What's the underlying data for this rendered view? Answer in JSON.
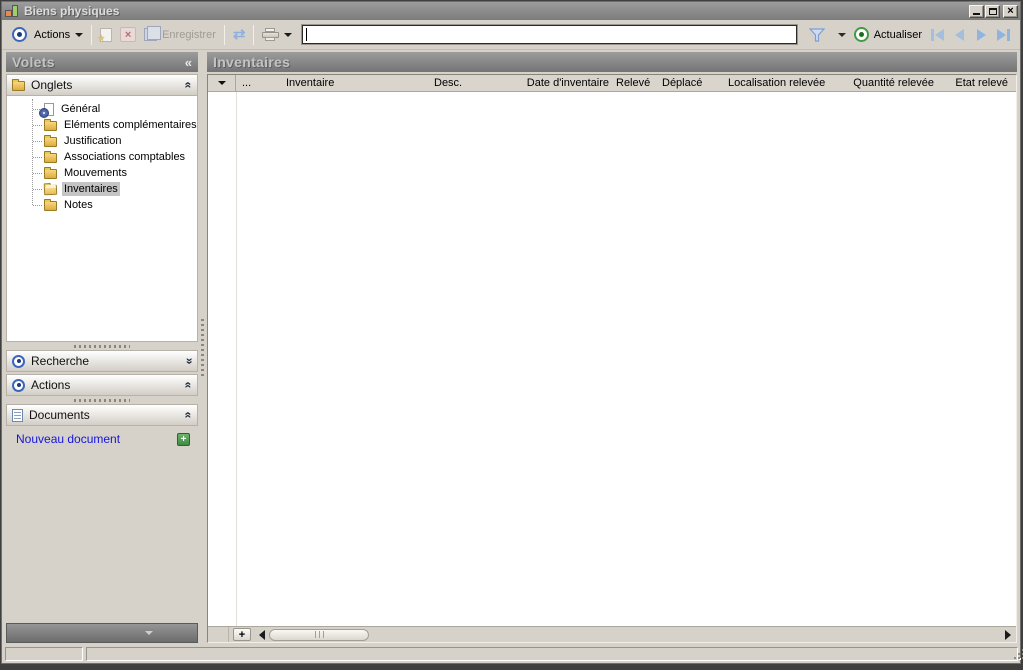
{
  "window": {
    "title": "Biens physiques"
  },
  "icons": {
    "close": "×",
    "collapse_left": "«",
    "double_chevron": "«",
    "sync_arrows": "⇄",
    "star": "★",
    "plus": "+"
  },
  "toolbar": {
    "actions_label": "Actions",
    "save_label": "Enregistrer",
    "refresh_label": "Actualiser",
    "search_value": ""
  },
  "sidebar": {
    "title": "Volets",
    "onglets": {
      "label": "Onglets",
      "items": [
        {
          "id": "general",
          "label": "Général",
          "icon": "page-gear",
          "selected": false
        },
        {
          "id": "elements-complementaires",
          "label": "Eléments complémentaires",
          "icon": "folder",
          "selected": false
        },
        {
          "id": "justification",
          "label": "Justification",
          "icon": "folder",
          "selected": false
        },
        {
          "id": "associations-comptables",
          "label": "Associations comptables",
          "icon": "folder",
          "selected": false
        },
        {
          "id": "mouvements",
          "label": "Mouvements",
          "icon": "folder",
          "selected": false
        },
        {
          "id": "inventaires",
          "label": "Inventaires",
          "icon": "folder-open",
          "selected": true
        },
        {
          "id": "notes",
          "label": "Notes",
          "icon": "folder",
          "selected": false
        }
      ]
    },
    "recherche_label": "Recherche",
    "actions_label": "Actions",
    "documents_label": "Documents",
    "new_document_label": "Nouveau document"
  },
  "main": {
    "title": "Inventaires",
    "table": {
      "columns": [
        "...",
        "Inventaire",
        "Desc.",
        "Date d'inventaire",
        "Relevé",
        "Déplacé",
        "Localisation relevée",
        "Quantité relevée",
        "Etat relevé"
      ],
      "rows": []
    }
  },
  "colors": {
    "accent_blue": "#3a66c0",
    "link_blue": "#1515dd",
    "folder_yellow": "#e8b84c",
    "selected_gray": "#c4c4c4",
    "panel_bg": "#d6d2ca",
    "header_gray": "#8a8a8a",
    "green_button": "#55a455"
  }
}
